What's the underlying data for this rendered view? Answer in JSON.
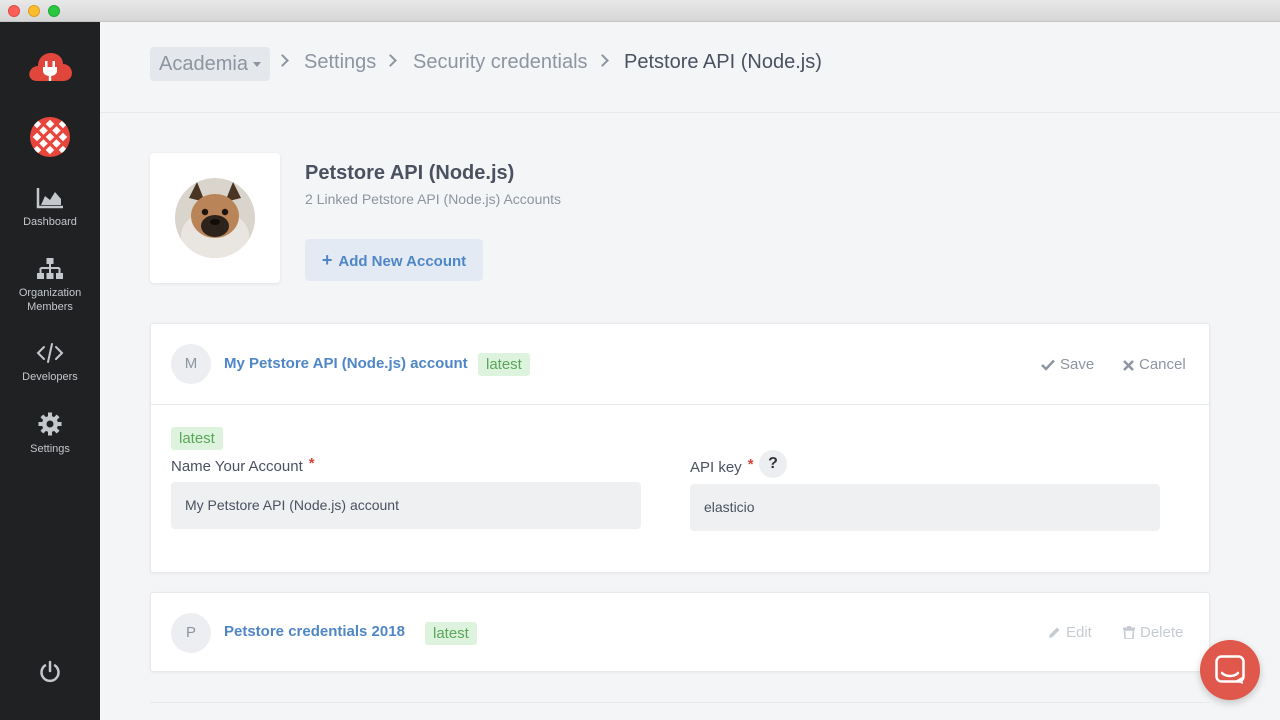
{
  "sidebar": {
    "items": [
      {
        "label": "Dashboard",
        "icon": "chart-area-icon"
      },
      {
        "label": "Organization Members",
        "icon": "sitemap-icon"
      },
      {
        "label": "Developers",
        "icon": "code-icon"
      },
      {
        "label": "Settings",
        "icon": "gear-icon"
      }
    ]
  },
  "breadcrumb": {
    "org": "Academia",
    "items": [
      "Settings",
      "Security credentials",
      "Petstore API (Node.js)"
    ]
  },
  "credential": {
    "title": "Petstore API (Node.js)",
    "subtitle": "2 Linked Petstore API (Node.js) Accounts",
    "add_label": "Add New Account"
  },
  "accounts": [
    {
      "initial": "M",
      "name": "My Petstore API (Node.js) account",
      "badge": "latest",
      "save_label": "Save",
      "cancel_label": "Cancel",
      "form": {
        "badge": "latest",
        "name_label": "Name Your Account",
        "name_value": "My Petstore API (Node.js) account",
        "key_label": "API key",
        "key_help": "?",
        "key_value": "elasticio",
        "required_mark": "*"
      }
    },
    {
      "initial": "P",
      "name": "Petstore credentials 2018",
      "badge": "latest",
      "edit_label": "Edit",
      "delete_label": "Delete"
    }
  ],
  "colors": {
    "sidebar_bg": "#1f2123",
    "accent": "#4f86c6",
    "badge_bg": "#ddf3dd",
    "badge_text": "#5aa65a",
    "chat": "#e0584b"
  }
}
